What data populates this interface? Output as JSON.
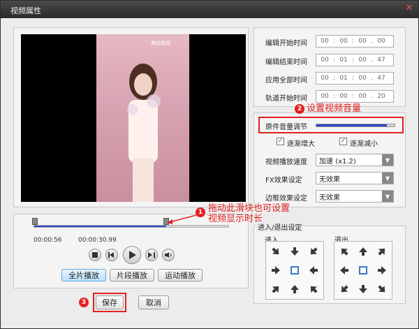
{
  "window": {
    "title": "视频属性",
    "close_glyph": "✕"
  },
  "video": {
    "logo_text": "美拍视频"
  },
  "time_fields": [
    {
      "label": "编辑开始时间",
      "parts": [
        "00",
        "00",
        "00",
        "00"
      ]
    },
    {
      "label": "编辑结束时间",
      "parts": [
        "00",
        "01",
        "00",
        "47"
      ]
    },
    {
      "label": "应用全部时间",
      "parts": [
        "00",
        "01",
        "00",
        "47"
      ]
    },
    {
      "label": "轨道开始时间",
      "parts": [
        "00",
        "00",
        "00",
        "20"
      ]
    }
  ],
  "volume": {
    "label": "原件音量调节",
    "level": 0.9
  },
  "checkboxes": [
    {
      "label": "逐渐增大",
      "checked": true
    },
    {
      "label": "逐渐减小",
      "checked": true
    }
  ],
  "selects": [
    {
      "label": "视频播放速度",
      "value": "加速 (x1.2)"
    },
    {
      "label": "FX效果设定",
      "value": "无效果"
    },
    {
      "label": "边框效果设定",
      "value": "无效果"
    }
  ],
  "transition": {
    "title": "进入/退出设定",
    "enter": "进入",
    "exit": "退出"
  },
  "timeline": {
    "start": "00:00:56",
    "end": "00:00:30.99",
    "progress": 0.68
  },
  "play_modes": [
    "全片播放",
    "片段播放",
    "运动播放"
  ],
  "buttons": {
    "save": "保存",
    "cancel": "取消"
  },
  "annotations": {
    "a1": {
      "num": "1",
      "text_line1": "拖动此滑块也可设置",
      "text_line2": "视频显示时长"
    },
    "a2": {
      "num": "2",
      "text": "设置视频音量"
    },
    "a3": {
      "num": "3"
    }
  },
  "colors": {
    "accent": "#e22020",
    "slider": "#2c44c4"
  }
}
